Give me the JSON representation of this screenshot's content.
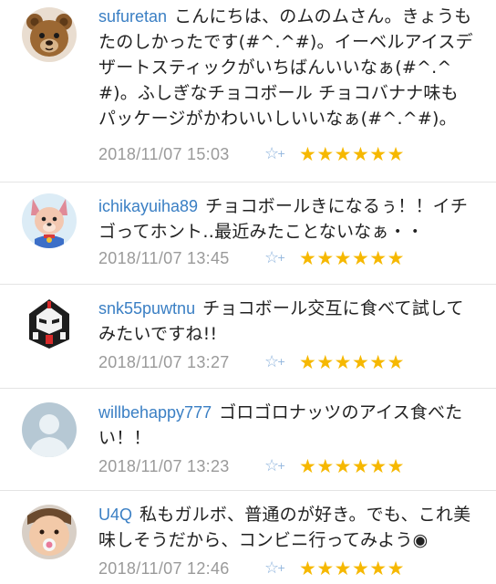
{
  "comments": [
    {
      "user": "sufuretan",
      "text": "こんにちは、のムのムさん。きょうもたのしかったです(#^.^#)。イーベルアイスデザートスティックがいちばんいいなぁ(#^.^#)。ふしぎなチョコボール チョコバナナ味もパッケージがかわいいしいいなぁ(#^.^#)。",
      "time": "2018/11/07 15:03",
      "stars": "★★★★★★",
      "rating_count": 6,
      "avatar_icon": "teddy-bear-avatar"
    },
    {
      "user": "ichikayuiha89",
      "text": "チョコボールきになるぅ！！イチゴってホント‥最近みたことないなぁ・・",
      "time": "2018/11/07 13:45",
      "stars": "★★★★★★",
      "rating_count": 6,
      "avatar_icon": "pink-dog-avatar"
    },
    {
      "user": "snk55puwtnu",
      "text": "チョコボール交互に食べて試してみたいですね!!",
      "time": "2018/11/07 13:27",
      "stars": "★★★★★★",
      "rating_count": 6,
      "avatar_icon": "robot-head-avatar"
    },
    {
      "user": "willbehappy777",
      "text": "ゴロゴロナッツのアイス食べたい！！",
      "time": "2018/11/07 13:23",
      "stars": "★★★★★★",
      "rating_count": 6,
      "avatar_icon": "default-person-avatar"
    },
    {
      "user": "U4Q",
      "text": "私もガルボ、普通のが好き。でも、これ美味しそうだから、コンビニ行ってみよう◉",
      "time": "2018/11/07 12:46",
      "stars": "★★★★★★",
      "rating_count": 6,
      "avatar_icon": "baby-photo-avatar"
    }
  ],
  "fav_icon": "☆",
  "fav_plus": "+",
  "colors": {
    "username": "#3a7fc4",
    "timestamp": "#9a9a9a",
    "star": "#f6b800",
    "fav_icon": "#8fb4dd",
    "divider": "#e4e4e4"
  }
}
